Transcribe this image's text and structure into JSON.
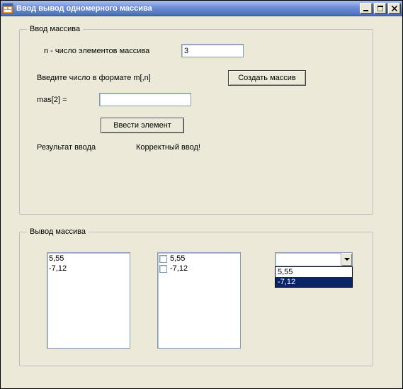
{
  "window": {
    "title": "Ввод вывод одномерного массива"
  },
  "input_group": {
    "legend": "Ввод массива",
    "n_label": "n - число элементов массива",
    "n_value": "3",
    "format_hint": "Введите число в формате m[,n]",
    "create_button": "Создать массив",
    "mas_label": "mas[2] =",
    "mas_value": "",
    "enter_button": "Ввести элемент",
    "result_label": "Результат ввода",
    "result_value": "Корректный ввод!"
  },
  "output_group": {
    "legend": "Вывод массива",
    "listbox_items": [
      "5,55",
      "-7,12"
    ],
    "checklist_items": [
      "5,55",
      "-7,12"
    ],
    "combo_value": "",
    "dropdown_options": [
      {
        "text": "5,55",
        "selected": false
      },
      {
        "text": "-7,12",
        "selected": true
      }
    ]
  }
}
